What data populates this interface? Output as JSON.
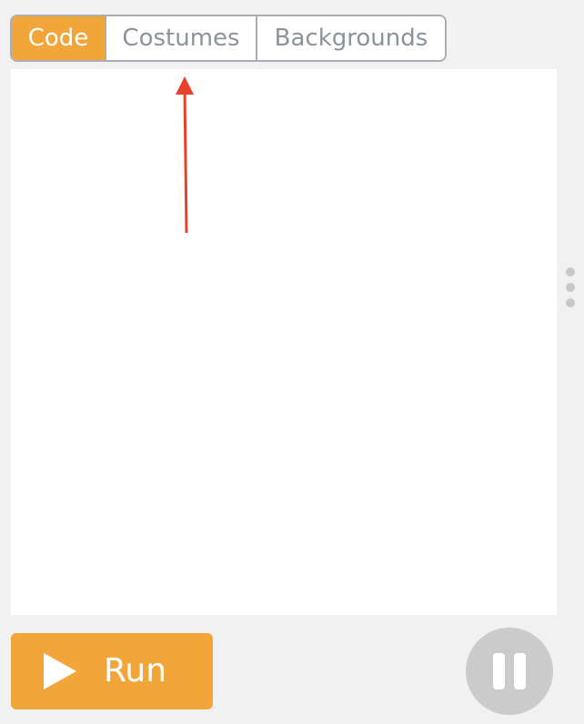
{
  "tabs": [
    {
      "label": "Code",
      "active": true
    },
    {
      "label": "Costumes",
      "active": false
    },
    {
      "label": "Backgrounds",
      "active": false
    }
  ],
  "run_button": {
    "label": "Run",
    "icon": "play-icon"
  },
  "pause_button": {
    "icon": "pause-icon"
  },
  "resize_handle": {
    "icon": "vertical-dots-icon"
  },
  "colors": {
    "accent": "#f2a63a",
    "tab_border": "#a9aeb4",
    "tab_text": "#8c939a",
    "background": "#f1f1f1",
    "editor": "#ffffff",
    "pause": "#cbcbcb",
    "annotation_arrow": "#e8402a"
  }
}
